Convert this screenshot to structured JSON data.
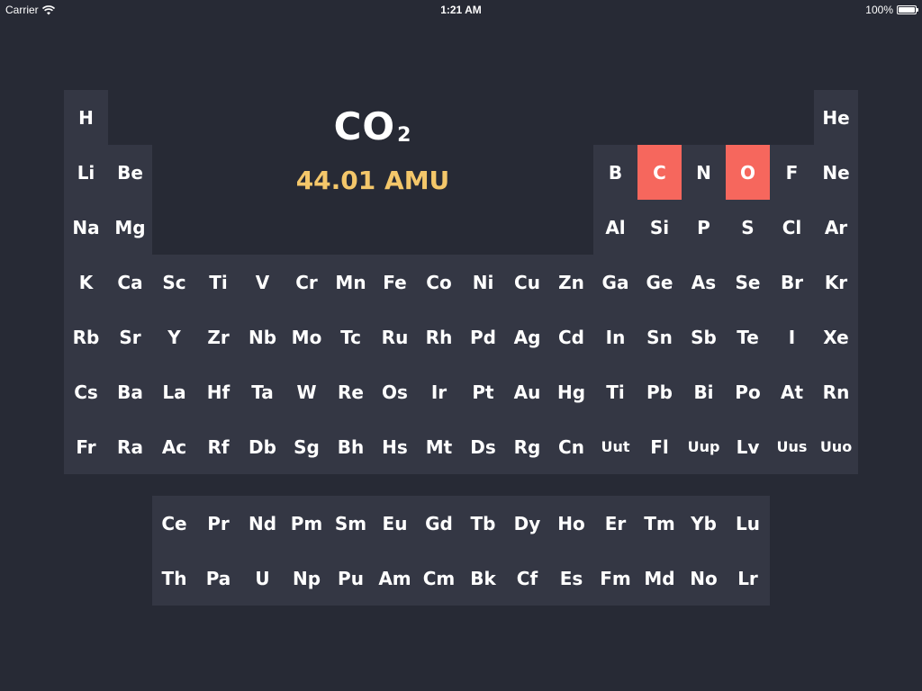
{
  "status_bar": {
    "carrier": "Carrier",
    "time": "1:21 AM",
    "battery": "100%"
  },
  "molecule": {
    "formula_base": "CO",
    "formula_subscript": "2",
    "mass": "44.01 AMU"
  },
  "colors": {
    "background": "#272a35",
    "panel": "#343744",
    "selected": "#f6675d",
    "mass_text": "#f4c76a"
  },
  "selected_elements": [
    "C",
    "O"
  ],
  "rows": [
    [
      "H",
      "",
      "",
      "",
      "",
      "",
      "",
      "",
      "",
      "",
      "",
      "",
      "",
      "",
      "",
      "",
      "",
      "He"
    ],
    [
      "Li",
      "Be",
      "",
      "",
      "",
      "",
      "",
      "",
      "",
      "",
      "",
      "",
      "B",
      "C",
      "N",
      "O",
      "F",
      "Ne"
    ],
    [
      "Na",
      "Mg",
      "",
      "",
      "",
      "",
      "",
      "",
      "",
      "",
      "",
      "",
      "Al",
      "Si",
      "P",
      "S",
      "Cl",
      "Ar"
    ],
    [
      "K",
      "Ca",
      "Sc",
      "Ti",
      "V",
      "Cr",
      "Mn",
      "Fe",
      "Co",
      "Ni",
      "Cu",
      "Zn",
      "Ga",
      "Ge",
      "As",
      "Se",
      "Br",
      "Kr"
    ],
    [
      "Rb",
      "Sr",
      "Y",
      "Zr",
      "Nb",
      "Mo",
      "Tc",
      "Ru",
      "Rh",
      "Pd",
      "Ag",
      "Cd",
      "In",
      "Sn",
      "Sb",
      "Te",
      "I",
      "Xe"
    ],
    [
      "Cs",
      "Ba",
      "La",
      "Hf",
      "Ta",
      "W",
      "Re",
      "Os",
      "Ir",
      "Pt",
      "Au",
      "Hg",
      "Ti",
      "Pb",
      "Bi",
      "Po",
      "At",
      "Rn"
    ],
    [
      "Fr",
      "Ra",
      "Ac",
      "Rf",
      "Db",
      "Sg",
      "Bh",
      "Hs",
      "Mt",
      "Ds",
      "Rg",
      "Cn",
      "Uut",
      "Fl",
      "Uup",
      "Lv",
      "Uus",
      "Uuo"
    ]
  ],
  "lanthanides": [
    "Ce",
    "Pr",
    "Nd",
    "Pm",
    "Sm",
    "Eu",
    "Gd",
    "Tb",
    "Dy",
    "Ho",
    "Er",
    "Tm",
    "Yb",
    "Lu"
  ],
  "actinides": [
    "Th",
    "Pa",
    "U",
    "Np",
    "Pu",
    "Am",
    "Cm",
    "Bk",
    "Cf",
    "Es",
    "Fm",
    "Md",
    "No",
    "Lr"
  ]
}
